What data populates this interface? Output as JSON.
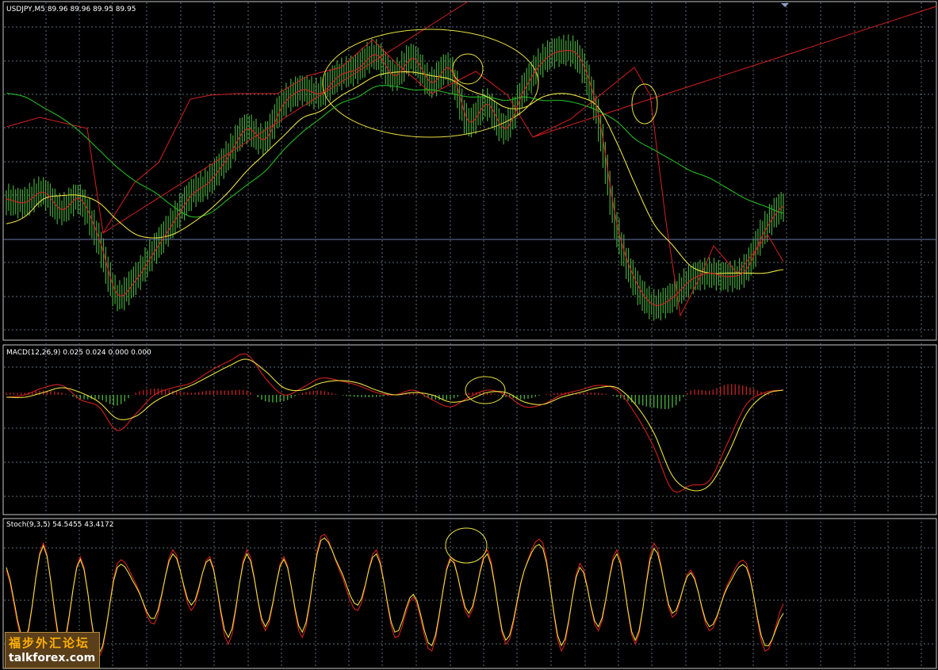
{
  "colors": {
    "background": "#000000",
    "grid": "#5f6e7a",
    "frame": "#c8c8c8",
    "bars": "#46a63c",
    "ma_fast": "#d42020",
    "ma_mid": "#e8e040",
    "ma_slow": "#22b822",
    "trendline": "#d42020",
    "hline": "#6b7ca8",
    "circle": "#e8e040",
    "macd_hist_pos": "#b52020",
    "macd_hist_neg": "#46a63c",
    "macd_main": "#e8e040",
    "macd_signal": "#d42020",
    "stoch_main": "#d42020",
    "stoch_signal": "#e8e040"
  },
  "chart_data": [
    {
      "type": "line",
      "panel": "price",
      "label": "USDJPY,M5 89.96 89.96 89.95 89.95",
      "symbol": "USDJPY",
      "timeframe": "M5",
      "ohlc_last": [
        89.96,
        89.96,
        89.95,
        89.95
      ],
      "grid": true,
      "series": [
        {
          "values": [
            89.93,
            89.92,
            89.95,
            89.9,
            89.93,
            89.82,
            89.66,
            89.7,
            89.78,
            89.86,
            89.94,
            89.98,
            90.05,
            90.13,
            90.1,
            90.2,
            90.24,
            90.23,
            90.28,
            90.3,
            90.34,
            90.28,
            90.33,
            90.26,
            90.3,
            90.15,
            90.2,
            90.13,
            90.24,
            90.32,
            90.35,
            90.33,
            90.17,
            89.86,
            89.7,
            89.63,
            89.65,
            89.7,
            89.72,
            89.71,
            89.73,
            89.84,
            89.91
          ]
        },
        {
          "values": [
            89.86,
            89.88,
            89.93,
            89.94,
            89.94,
            89.92,
            89.87,
            89.83,
            89.82,
            89.83,
            89.86,
            89.9,
            89.95,
            90.01,
            90.06,
            90.11,
            90.16,
            90.18,
            90.22,
            90.25,
            90.28,
            90.29,
            90.29,
            90.28,
            90.27,
            90.24,
            90.22,
            90.19,
            90.19,
            90.22,
            90.23,
            90.22,
            90.19,
            90.09,
            89.97,
            89.86,
            89.8,
            89.74,
            89.72,
            89.72,
            89.72,
            89.72,
            89.73
          ]
        },
        {
          "values": [
            90.23,
            90.22,
            90.19,
            90.16,
            90.12,
            90.07,
            90.02,
            89.98,
            89.95,
            89.91,
            89.88,
            89.89,
            89.93,
            89.97,
            90.01,
            90.07,
            90.12,
            90.16,
            90.2,
            90.22,
            90.25,
            90.25,
            90.24,
            90.24,
            90.23,
            90.22,
            90.22,
            90.21,
            90.22,
            90.21,
            90.21,
            90.2,
            90.18,
            90.15,
            90.1,
            90.07,
            90.04,
            90.01,
            89.99,
            89.96,
            89.93,
            89.91,
            89.89
          ]
        }
      ]
    },
    {
      "type": "bar",
      "panel": "macd",
      "label": "MACD(12,26,9) 0.025 0.024 0.000 0.000",
      "params": [
        12,
        26,
        9
      ],
      "readout": [
        0.025,
        0.024,
        0.0,
        0.0
      ],
      "grid": true,
      "series": [
        {
          "values": [
            -0.01,
            0.0,
            0.03,
            0.04,
            -0.02,
            -0.05,
            -0.15,
            -0.08,
            0.0,
            0.03,
            0.05,
            0.1,
            0.14,
            0.17,
            0.07,
            0.0,
            0.03,
            0.07,
            0.06,
            0.04,
            0.01,
            0.0,
            0.02,
            -0.02,
            -0.05,
            -0.01,
            0.02,
            0.0,
            -0.05,
            -0.04,
            0.0,
            0.02,
            0.04,
            0.02,
            -0.08,
            -0.22,
            -0.4,
            -0.38,
            -0.36,
            -0.2,
            -0.04,
            0.01,
            0.02
          ]
        },
        {
          "values": [
            -0.01,
            -0.01,
            0.01,
            0.03,
            0.01,
            -0.03,
            -0.1,
            -0.09,
            -0.03,
            0.01,
            0.04,
            0.08,
            0.12,
            0.15,
            0.1,
            0.03,
            0.02,
            0.05,
            0.06,
            0.05,
            0.02,
            0.0,
            0.01,
            0.0,
            -0.03,
            -0.02,
            0.01,
            0.01,
            -0.03,
            -0.04,
            -0.01,
            0.01,
            0.03,
            0.03,
            -0.04,
            -0.16,
            -0.34,
            -0.4,
            -0.38,
            -0.25,
            -0.08,
            0.0,
            0.02
          ]
        },
        {
          "values": [
            0.01,
            0.01,
            0.02,
            0.01,
            -0.02,
            -0.02,
            -0.05,
            0.01,
            0.03,
            0.02,
            0.01,
            0.02,
            0.02,
            0.02,
            -0.03,
            -0.03,
            0.01,
            0.02,
            0.0,
            -0.01,
            -0.01,
            0.0,
            0.01,
            -0.02,
            -0.02,
            0.01,
            0.01,
            -0.01,
            -0.02,
            0.0,
            0.01,
            0.01,
            0.01,
            -0.01,
            -0.04,
            -0.06,
            -0.06,
            0.02,
            0.02,
            0.05,
            0.04,
            0.01,
            0.0
          ]
        }
      ]
    },
    {
      "type": "line",
      "panel": "stochastic",
      "label": "Stoch(9,3,5) 54.5455 43.4172",
      "params": [
        9,
        3,
        5
      ],
      "readout": [
        54.5455,
        43.4172
      ],
      "ylim": [
        0,
        100
      ],
      "grid": true,
      "series": [
        {
          "values": [
            70,
            15,
            90,
            10,
            80,
            5,
            75,
            60,
            30,
            85,
            40,
            80,
            15,
            85,
            25,
            80,
            20,
            95,
            70,
            40,
            85,
            20,
            50,
            10,
            80,
            35,
            85,
            15,
            70,
            90,
            10,
            75,
            25,
            85,
            15,
            90,
            35,
            70,
            25,
            60,
            75,
            10,
            45
          ]
        },
        {
          "values": [
            72,
            18,
            88,
            14,
            78,
            8,
            72,
            58,
            34,
            82,
            44,
            78,
            20,
            82,
            28,
            78,
            24,
            92,
            72,
            44,
            82,
            24,
            52,
            14,
            78,
            38,
            82,
            18,
            70,
            86,
            14,
            72,
            28,
            82,
            18,
            86,
            38,
            68,
            28,
            58,
            72,
            14,
            38
          ]
        }
      ]
    }
  ]
}
